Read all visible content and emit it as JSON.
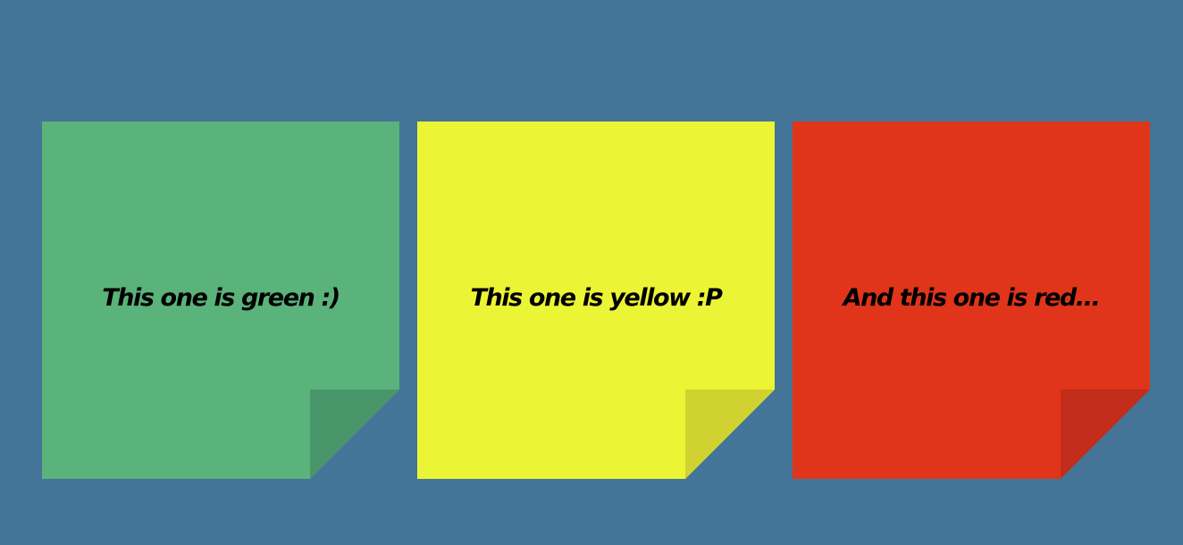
{
  "background_color": "#447598",
  "notes": [
    {
      "text": "This one is green :)",
      "color": "#5ab37a",
      "fold_color": "#48966a"
    },
    {
      "text": "This one is yellow :P",
      "color": "#ecf535",
      "fold_color": "#d0d22f"
    },
    {
      "text": "And this one is red...",
      "color": "#e0351a",
      "fold_color": "#c12d1a"
    }
  ]
}
